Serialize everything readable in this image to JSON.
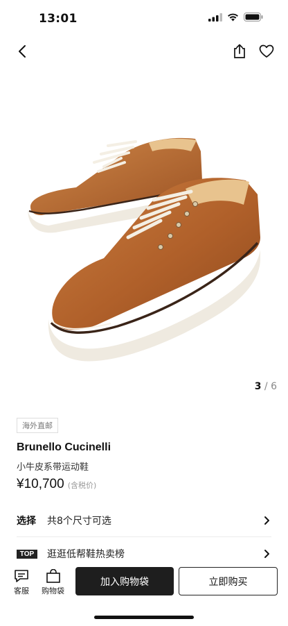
{
  "status_bar": {
    "time": "13:01"
  },
  "nav": {
    "icons": [
      "back-arrow-icon",
      "share-icon",
      "heart-icon"
    ]
  },
  "gallery": {
    "current": "3",
    "separator": " / ",
    "total": "6"
  },
  "product": {
    "tag": "海外直邮",
    "brand": "Brunello Cucinelli",
    "name": "小牛皮系带运动鞋",
    "price": "¥10,700",
    "price_note": "(含税价)"
  },
  "options": {
    "select_label": "选择",
    "select_text": "共8个尺寸可选",
    "top_badge": "TOP",
    "ranking_text": "逛逛低帮鞋热卖榜"
  },
  "bottom_bar": {
    "service_label": "客服",
    "bag_label": "购物袋",
    "add_to_bag": "加入购物袋",
    "buy_now": "立即购买"
  },
  "colors": {
    "accent": "#1e1e1e",
    "leather": "#b8652a",
    "sole": "#efeae0"
  }
}
